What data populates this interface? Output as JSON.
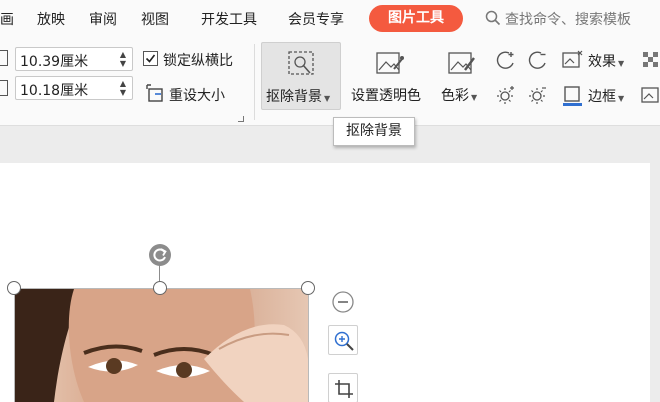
{
  "menu": {
    "items": [
      "画",
      "放映",
      "审阅",
      "视图",
      "开发工具",
      "会员专享"
    ],
    "active_tab": "图片工具",
    "search_placeholder": "查找命令、搜索模板"
  },
  "ribbon": {
    "width_value": "10.39厘米",
    "height_value": "10.18厘米",
    "lock_ratio_label": "锁定纵横比",
    "lock_ratio_checked": true,
    "reset_size_label": "重设大小",
    "remove_bg_label": "抠除背景",
    "set_transparent_label": "设置透明色",
    "color_label": "色彩",
    "effects_label": "效果",
    "border_label": "边框"
  },
  "tooltip": {
    "text": "抠除背景"
  },
  "colors": {
    "accent": "#f45a3f",
    "border_blue": "#2f6fd0"
  }
}
